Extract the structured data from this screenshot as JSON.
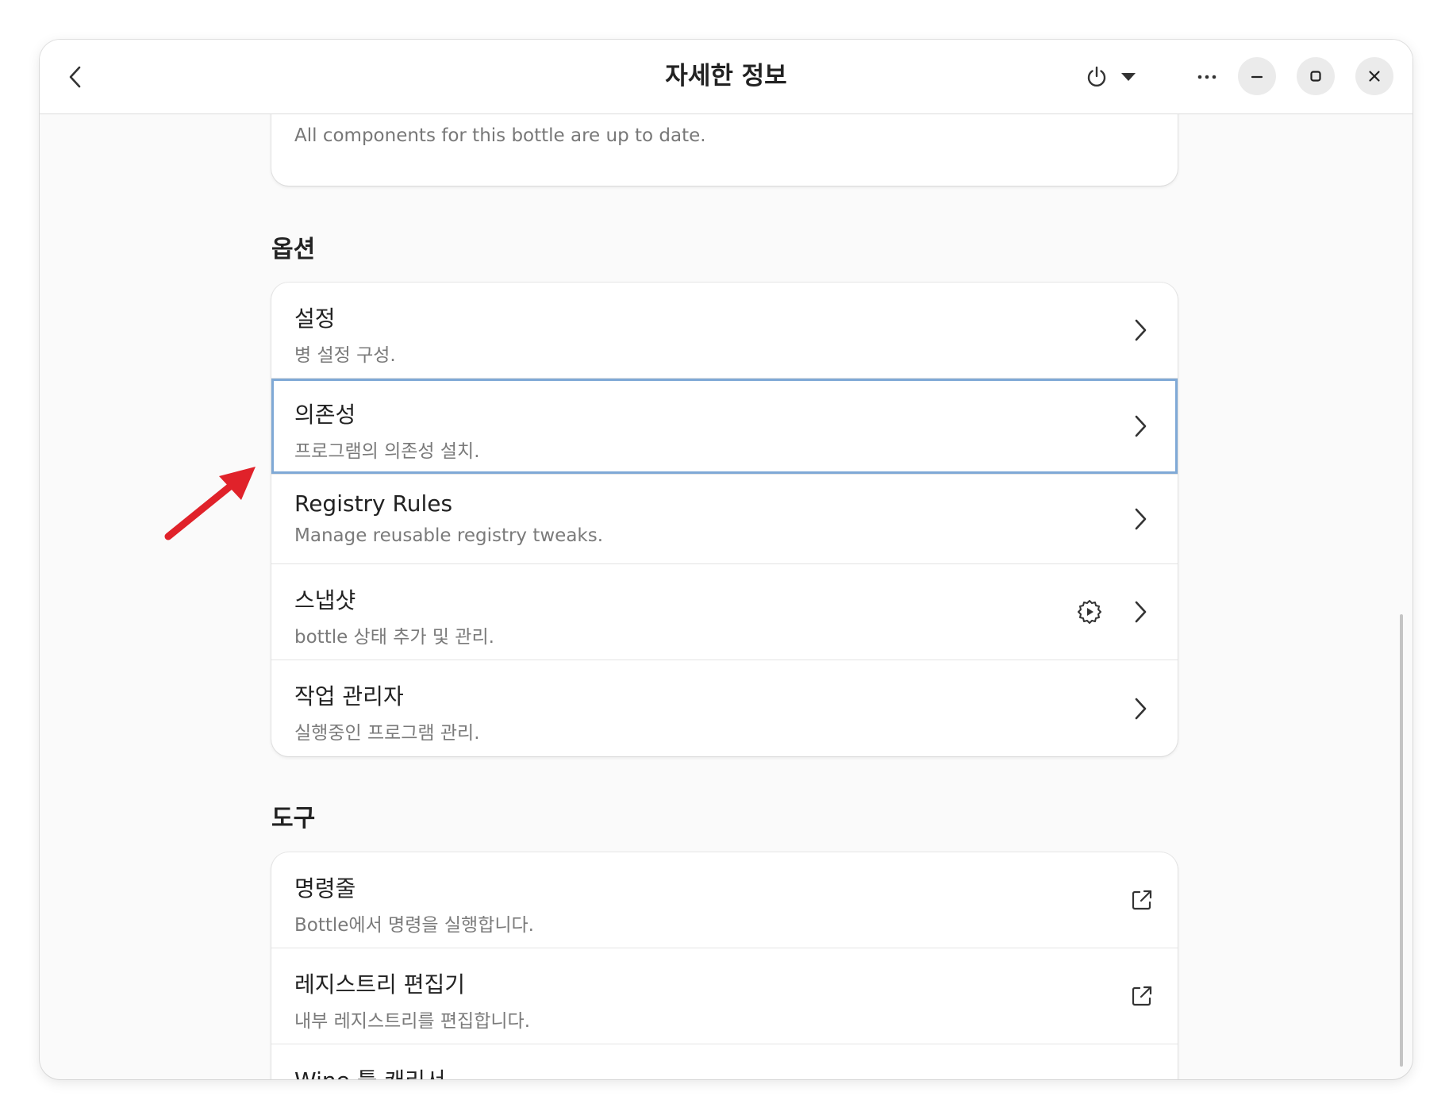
{
  "header": {
    "title": "자세한 정보",
    "back_icon": "chevron-left-icon",
    "power_icon": "power-icon",
    "dropdown_icon": "caret-down-icon",
    "menu_icon": "ellipsis-icon",
    "minimize_icon": "minimize-icon",
    "maximize_icon": "maximize-icon",
    "close_icon": "close-icon"
  },
  "top_card": {
    "status": "All components for this bottle are up to date."
  },
  "options": {
    "heading": "옵션",
    "rows": [
      {
        "title": "설정",
        "subtitle": "병 설정 구성."
      },
      {
        "title": "의존성",
        "subtitle": "프로그램의 의존성 설치."
      },
      {
        "title": "Registry Rules",
        "subtitle": "Manage reusable registry tweaks."
      },
      {
        "title": "스냅샷",
        "subtitle": "bottle 상태 추가 및 관리."
      },
      {
        "title": "작업 관리자",
        "subtitle": "실행중인 프로그램 관리."
      }
    ]
  },
  "tools": {
    "heading": "도구",
    "rows": [
      {
        "title": "명령줄",
        "subtitle": "Bottle에서 명령을 실행합니다."
      },
      {
        "title": "레지스트리 편집기",
        "subtitle": "내부 레지스트리를 편집합니다."
      },
      {
        "title": "Wine 툴 캐리서",
        "subtitle": ""
      }
    ]
  },
  "colors": {
    "focus_ring": "#7fa9d6",
    "annotation_arrow": "#e0222a"
  }
}
